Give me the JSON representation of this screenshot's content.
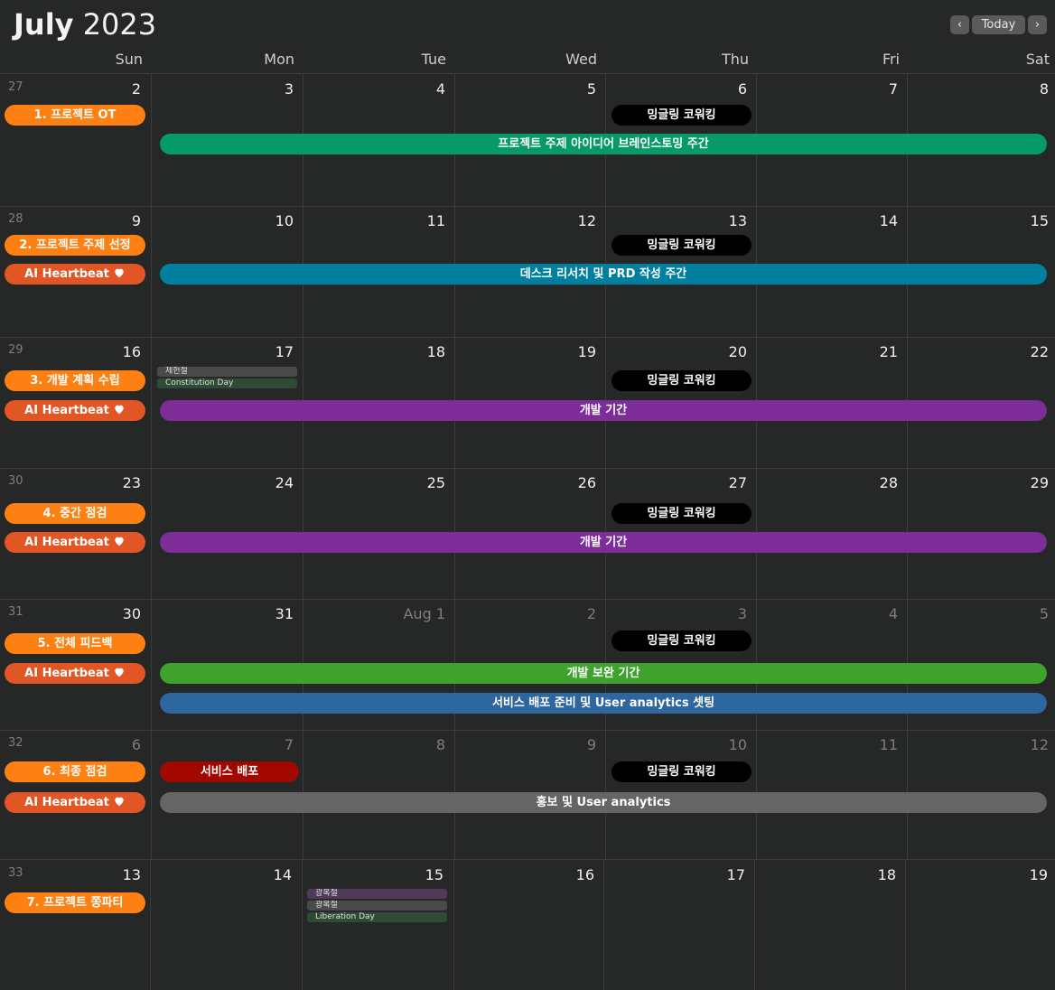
{
  "header": {
    "month": "July",
    "year": "2023",
    "prev_glyph": "‹",
    "next_glyph": "›",
    "today_label": "Today"
  },
  "weekdays": [
    "Sun",
    "Mon",
    "Tue",
    "Wed",
    "Thu",
    "Fri",
    "Sat"
  ],
  "weeks": [
    {
      "number": "27",
      "days": [
        "2",
        "3",
        "4",
        "5",
        "6",
        "7",
        "8"
      ],
      "events": {
        "orange": "1. 프로젝트 OT",
        "thu": "밍글링 코워킹",
        "span1": "프로젝트 주제 아이디어 브레인스토밍 주간"
      }
    },
    {
      "number": "28",
      "days": [
        "9",
        "10",
        "11",
        "12",
        "13",
        "14",
        "15"
      ],
      "events": {
        "orange": "2. 프로젝트 주제 선정",
        "heartbeat": "AI Heartbeat",
        "thu": "밍글링 코워킹",
        "span1": "데스크 리서치 및 PRD 작성 주간"
      }
    },
    {
      "number": "29",
      "days": [
        "16",
        "17",
        "18",
        "19",
        "20",
        "21",
        "22"
      ],
      "holidays": [
        "제헌절",
        "Constitution Day"
      ],
      "events": {
        "orange": "3. 개발 계획 수립",
        "heartbeat": "AI Heartbeat",
        "thu": "밍글링 코워킹",
        "span1": "개발 기간"
      }
    },
    {
      "number": "30",
      "days": [
        "23",
        "24",
        "25",
        "26",
        "27",
        "28",
        "29"
      ],
      "events": {
        "orange": "4. 중간 점검",
        "heartbeat": "AI Heartbeat",
        "thu": "밍글링 코워킹",
        "span1": "개발 기간"
      }
    },
    {
      "number": "31",
      "days": [
        "30",
        "31",
        "Aug 1",
        "2",
        "3",
        "4",
        "5"
      ],
      "events": {
        "orange": "5. 전체 피드백",
        "heartbeat": "AI Heartbeat",
        "thu": "밍글링 코워킹",
        "span1": "개발 보완 기간",
        "span2": "서비스 배포 준비 및 User analytics 셋팅"
      }
    },
    {
      "number": "32",
      "days": [
        "6",
        "7",
        "8",
        "9",
        "10",
        "11",
        "12"
      ],
      "events": {
        "orange": "6. 최종 점검",
        "heartbeat": "AI Heartbeat",
        "mon": "서비스 배포",
        "thu": "밍글링 코워킹",
        "span1": "홍보 및 User analytics"
      }
    },
    {
      "number": "33",
      "days": [
        "13",
        "14",
        "15",
        "16",
        "17",
        "18",
        "19"
      ],
      "holidays": [
        "광복절",
        "광복절",
        "Liberation Day"
      ],
      "events": {
        "orange": "7. 프로젝트 쫑파티"
      }
    }
  ],
  "colors": {
    "background": "#262727",
    "orange": "#ff8012",
    "heartbeat": "#e25525",
    "black_pill": "#000000",
    "green": "#059a67",
    "teal": "#00809e",
    "purple": "#7c2d97",
    "lime": "#3ea22c",
    "blue": "#2e66a0",
    "red": "#a10800",
    "gray": "#656565"
  },
  "icons": {
    "heart": "heart-icon",
    "prev": "chevron-left-icon",
    "next": "chevron-right-icon"
  }
}
